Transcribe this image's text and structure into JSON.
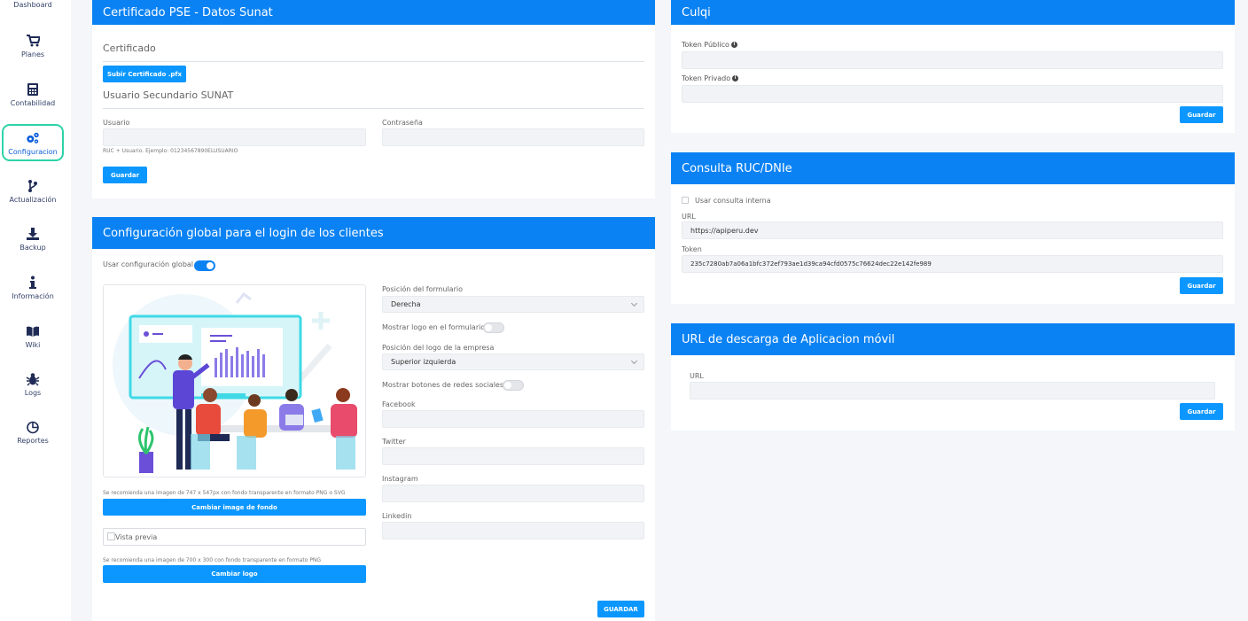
{
  "sidebar": {
    "items": [
      {
        "label": "Dashboard",
        "icon": "dashboard-icon"
      },
      {
        "label": "Planes",
        "icon": "cart-icon"
      },
      {
        "label": "Contabilidad",
        "icon": "calculator-icon"
      },
      {
        "label": "Configuracion",
        "icon": "cogs-icon",
        "active": true
      },
      {
        "label": "Actualización",
        "icon": "branch-icon"
      },
      {
        "label": "Backup",
        "icon": "download-icon"
      },
      {
        "label": "Información",
        "icon": "info-icon"
      },
      {
        "label": "Wiki",
        "icon": "book-icon"
      },
      {
        "label": "Logs",
        "icon": "bug-icon"
      },
      {
        "label": "Reportes",
        "icon": "pie-chart-icon"
      }
    ]
  },
  "pse": {
    "title": "Certificado PSE - Datos Sunat",
    "cert_label": "Certificado",
    "upload_button": "Subir Certificado .pfx",
    "secondary_user_label": "Usuario Secundario SUNAT",
    "user_label": "Usuario",
    "user_value": "",
    "password_label": "Contraseña",
    "password_value": "",
    "user_help": "RUC + Usuario. Ejemplo: 01234567890ELUSUARIO",
    "save_button": "Guardar"
  },
  "login": {
    "title": "Configuración global para el login de los clientes",
    "use_global_label": "Usar configuración global",
    "use_global_on": true,
    "bg_recommend": "Se recomienda una imagen de 747 x 547px con fondo transparente en formato PNG o SVG",
    "change_bg_button": "Cambiar image de fondo",
    "preview_label": "Vista previa",
    "logo_recommend": "Se recomienda una imagen de 700 x 300 con fondo transparente en formato PNG",
    "change_logo_button": "Cambiar logo",
    "form_position_label": "Posición del formulario",
    "form_position_value": "Derecha",
    "show_logo_label": "Mostrar logo en el formulario",
    "show_logo_on": false,
    "logo_position_label": "Posición del logo de la empresa",
    "logo_position_value": "Superior izquierda",
    "show_social_label": "Mostrar botones de redes sociales",
    "show_social_on": false,
    "facebook_label": "Facebook",
    "twitter_label": "Twitter",
    "instagram_label": "Instagram",
    "linkedin_label": "Linkedin",
    "save_button": "GUARDAR"
  },
  "culqi": {
    "title": "Culqi",
    "public_token_label": "Token Público",
    "private_token_label": "Token Privado",
    "public_token_value": "",
    "private_token_value": "",
    "save_button": "Guardar"
  },
  "ruc": {
    "title": "Consulta RUC/DNIe",
    "internal_label": "Usar consulta interna",
    "url_label": "URL",
    "url_value": "https://apiperu.dev",
    "token_label": "Token",
    "token_value": "235c7280ab7a06a1bfc372ef793ae1d39ca94cfd0575c76624dec22e142fe989",
    "save_button": "Guardar"
  },
  "mobile": {
    "title": "URL de descarga de Aplicacion móvil",
    "url_label": "URL",
    "url_value": "",
    "save_button": "Guardar"
  },
  "colors": {
    "primary": "#0b82f3",
    "button": "#0b97ff",
    "active_outline": "#2ed3a8"
  }
}
